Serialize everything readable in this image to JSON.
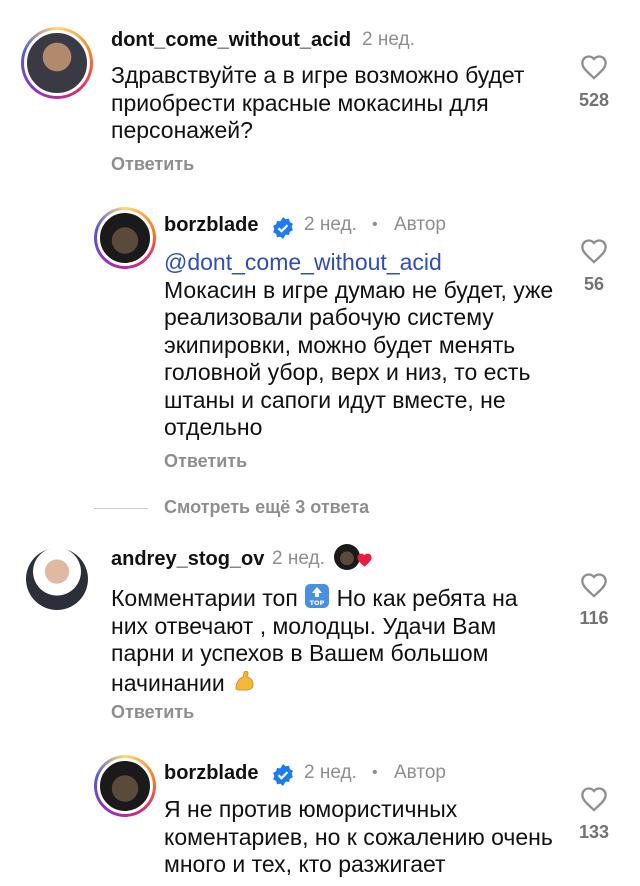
{
  "comments": [
    {
      "username": "dont_come_without_acid",
      "time": "2 нед.",
      "text": "Здравствуйте а в игре возможно будет приобрести красные мокасины для персонажей?",
      "likes": "528",
      "reply": "Ответить"
    },
    {
      "username": "borzblade",
      "time": "2 нед.",
      "author_label": "Автор",
      "mention": "@dont_come_without_acid",
      "text": "Мокасин в игре думаю не будет, уже реализовали рабочую систему экипировки, можно будет менять головной убор, верх и низ, то есть штаны и сапоги идут вместе, не отдельно",
      "likes": "56",
      "reply": "Ответить"
    },
    {
      "username": "andrey_stog_ov",
      "time": "2 нед.",
      "text_a": "Комментарии топ",
      "text_b": "Но как ребята на них отвечают , молодцы. Удачи Вам парни и успехов в Вашем большом начинании",
      "likes": "116",
      "reply": "Ответить"
    },
    {
      "username": "borzblade",
      "time": "2 нед.",
      "author_label": "Автор",
      "text": "Я не против юмористичных коментариев, но к сожалению очень много и тех, кто разжигает",
      "likes": "133"
    }
  ],
  "view_more": "Смотреть ещё 3 ответа",
  "colors": {
    "mention": "#2f4fb0",
    "verified": "#1d7bf2",
    "muted": "#8e8e8e"
  }
}
